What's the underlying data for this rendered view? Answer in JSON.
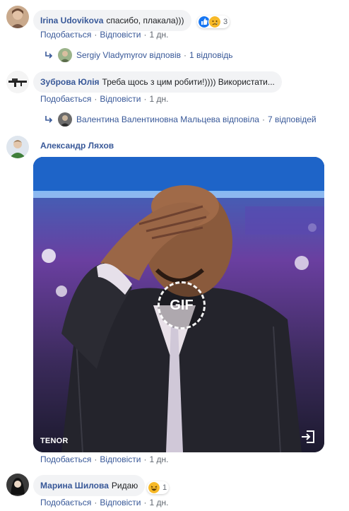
{
  "comments": [
    {
      "author": "Irina Udovikova",
      "text": "спасибо, плакала)))",
      "reactions_count": "3",
      "actions": {
        "like": "Подобається",
        "reply": "Відповісти",
        "time": "1 дн."
      },
      "reply_summary": {
        "who": "Sergiy Vladymyrov відповів",
        "count": "1 відповідь"
      }
    },
    {
      "author": "Зуброва Юлія",
      "text": "Треба щось з цим робити!)))) Використати...",
      "actions": {
        "like": "Подобається",
        "reply": "Відповісти",
        "time": "1 дн."
      },
      "reply_summary": {
        "who": "Валентина Валентиновна Мальцева відповіла",
        "count": "7 відповідей"
      }
    },
    {
      "author": "Александр Ляхов",
      "gif": {
        "badge": "GIF",
        "source": "TENOR"
      },
      "actions": {
        "like": "Подобається",
        "reply": "Відповісти",
        "time": "1 дн."
      }
    },
    {
      "author": "Марина Шилова",
      "text": "Ридаю",
      "reactions_count": "1",
      "actions": {
        "like": "Подобається",
        "reply": "Відповісти",
        "time": "1 дн."
      }
    }
  ],
  "separator": "·",
  "colors": {
    "link": "#385898",
    "bubble": "#f2f3f5",
    "meta": "#606770",
    "like": "#1877f2",
    "haha": "#f7b928"
  }
}
